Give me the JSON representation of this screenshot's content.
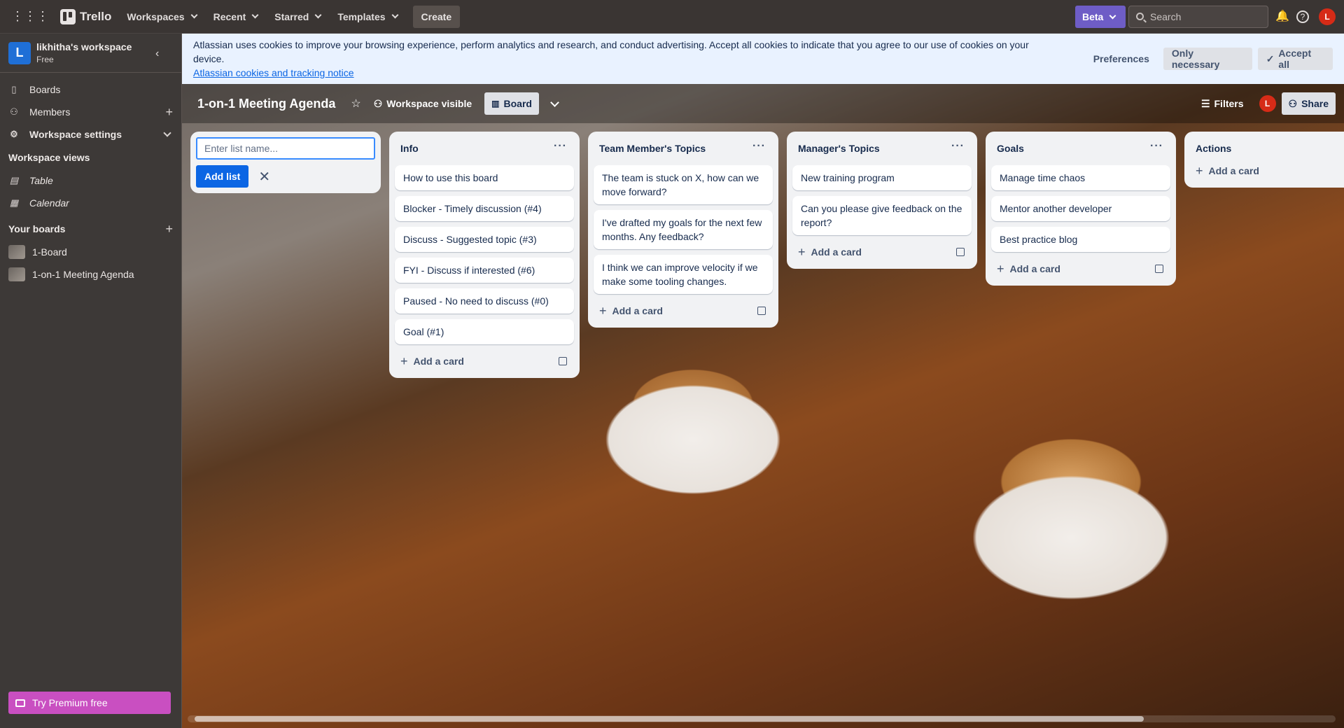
{
  "topbar": {
    "app_name": "Trello",
    "menus": [
      "Workspaces",
      "Recent",
      "Starred",
      "Templates"
    ],
    "create_label": "Create",
    "beta_label": "Beta",
    "search_placeholder": "Search",
    "avatar_initial": "L"
  },
  "sidebar": {
    "workspace_initial": "L",
    "workspace_name": "likhitha's workspace",
    "workspace_plan": "Free",
    "nav": [
      {
        "label": "Boards",
        "icon": "trello-icon"
      },
      {
        "label": "Members",
        "icon": "person-icon"
      },
      {
        "label": "Workspace settings",
        "icon": "gear-icon"
      }
    ],
    "views_heading": "Workspace views",
    "views": [
      {
        "label": "Table",
        "icon": "table-icon"
      },
      {
        "label": "Calendar",
        "icon": "calendar-icon"
      }
    ],
    "boards_heading": "Your boards",
    "boards": [
      "1-Board",
      "1-on-1 Meeting Agenda"
    ],
    "premium_label": "Try Premium free"
  },
  "cookie_banner": {
    "text": "Atlassian uses cookies to improve your browsing experience, perform analytics and research, and conduct advertising. Accept all cookies to indicate that you agree to our use of cookies on your device.",
    "link": "Atlassian cookies and tracking notice",
    "preferences": "Preferences",
    "only_necessary": "Only necessary",
    "accept_all": "Accept all"
  },
  "board_header": {
    "title": "1-on-1 Meeting Agenda",
    "visibility": "Workspace visible",
    "view": "Board",
    "filters": "Filters",
    "avatar_initial": "L",
    "share": "Share"
  },
  "new_list": {
    "placeholder": "Enter list name...",
    "add_label": "Add list"
  },
  "add_card_label": "Add a card",
  "lists": [
    {
      "title": "Info",
      "cards": [
        "How to use this board",
        "Blocker - Timely discussion (#4)",
        "Discuss - Suggested topic (#3)",
        "FYI - Discuss if interested (#6)",
        "Paused - No need to discuss (#0)",
        "Goal (#1)"
      ]
    },
    {
      "title": "Team Member's Topics",
      "cards": [
        "The team is stuck on X, how can we move forward?",
        "I've drafted my goals for the next few months. Any feedback?",
        "I think we can improve velocity if we make some tooling changes."
      ]
    },
    {
      "title": "Manager's Topics",
      "cards": [
        "New training program",
        "Can you please give feedback on the report?"
      ]
    },
    {
      "title": "Goals",
      "cards": [
        "Manage time chaos",
        "Mentor another developer",
        "Best practice blog"
      ]
    },
    {
      "title": "Actions",
      "cards": []
    }
  ]
}
